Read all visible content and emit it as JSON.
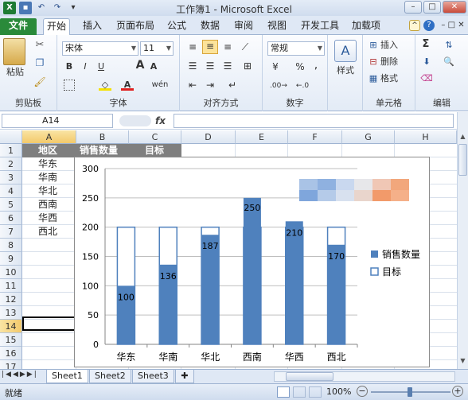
{
  "window": {
    "title": "工作簿1 - Microsoft Excel",
    "excel_icon": "X",
    "qa_undo": "↶",
    "qa_redo": "↷",
    "qa_dropdown": "▾",
    "minimize": "–",
    "maximize": "□",
    "close": "✕"
  },
  "tabs": [
    "文件",
    "开始",
    "插入",
    "页面布局",
    "公式",
    "数据",
    "审阅",
    "视图",
    "开发工具",
    "加载项"
  ],
  "ribbon": {
    "paste": "粘贴",
    "clipboard": "剪贴板",
    "font_name": "宋体",
    "font_size": "11",
    "bold": "B",
    "italic": "I",
    "underline": "U",
    "font_group": "字体",
    "align_group": "对齐方式",
    "number_format": "常规",
    "currency": "¥",
    "percent": "%",
    "comma": ",",
    "number_group": "数字",
    "styles": "样式",
    "insert": "插入",
    "delete": "删除",
    "format": "格式",
    "cells_group": "单元格",
    "sum": "Σ",
    "editing_group": "编辑"
  },
  "formula_bar": {
    "name_box": "A14",
    "fx": "fx",
    "value": ""
  },
  "grid": {
    "columns": [
      "A",
      "B",
      "C",
      "D",
      "E",
      "F",
      "G",
      "H"
    ],
    "rows": [
      "1",
      "2",
      "3",
      "4",
      "5",
      "6",
      "7",
      "8",
      "9",
      "10",
      "11",
      "12",
      "13",
      "14",
      "15",
      "16",
      "17"
    ],
    "selected_cell": "A14",
    "header_row": [
      "地区",
      "销售数量",
      "目标"
    ],
    "regions": [
      "华东",
      "华南",
      "华北",
      "西南",
      "华西",
      "西北"
    ]
  },
  "chart_data": {
    "type": "bar",
    "categories": [
      "华东",
      "华南",
      "华北",
      "西南",
      "华西",
      "西北"
    ],
    "series": [
      {
        "name": "销售数量",
        "values": [
          100,
          136,
          187,
          250,
          210,
          170
        ],
        "color": "#4f81bd"
      },
      {
        "name": "目标",
        "values": [
          200,
          200,
          200,
          200,
          200,
          200
        ],
        "color": "#ffffff"
      }
    ],
    "data_labels": [
      "100",
      "136",
      "187",
      "250",
      "210",
      "170"
    ],
    "ylim": [
      0,
      300
    ],
    "yticks": [
      "0",
      "50",
      "100",
      "150",
      "200",
      "250",
      "300"
    ],
    "grid": true,
    "legend": "right",
    "overlap": true
  },
  "sheets": [
    "Sheet1",
    "Sheet2",
    "Sheet3"
  ],
  "active_sheet": "Sheet1",
  "status": {
    "mode": "就绪",
    "zoom": "100%",
    "zoom_minus": "−",
    "zoom_plus": "+"
  }
}
